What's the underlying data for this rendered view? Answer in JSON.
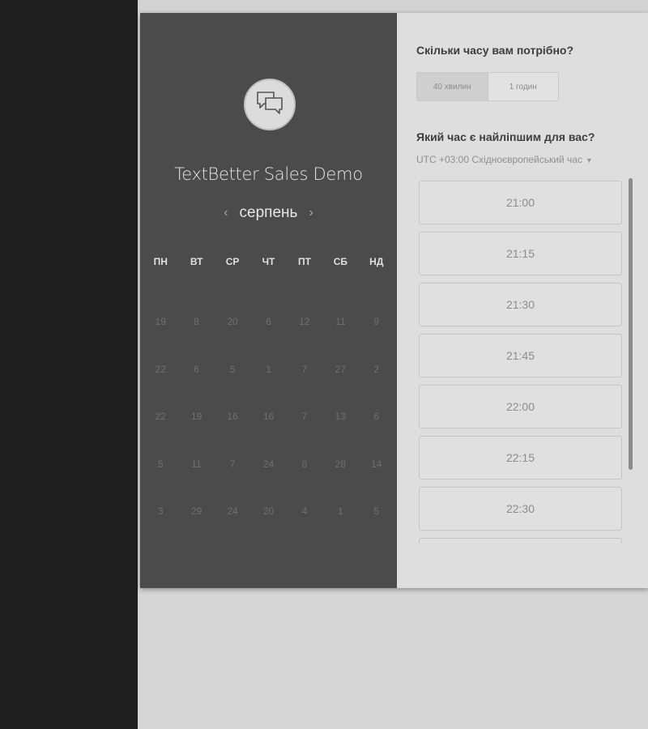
{
  "event": {
    "title": "TextBetter Sales Demo",
    "icon": "chat-bubbles-icon"
  },
  "calendar": {
    "month": "серпень",
    "prev_arrow": "‹",
    "next_arrow": "›",
    "weekdays": [
      "ПН",
      "ВТ",
      "СР",
      "ЧТ",
      "ПТ",
      "СБ",
      "НД"
    ],
    "weeks": [
      [
        "19",
        "8",
        "20",
        "6",
        "12",
        "11",
        "9"
      ],
      [
        "22",
        "6",
        "5",
        "1",
        "7",
        "27",
        "2"
      ],
      [
        "22",
        "19",
        "16",
        "16",
        "7",
        "13",
        "6"
      ],
      [
        "5",
        "11",
        "7",
        "24",
        "8",
        "28",
        "14"
      ],
      [
        "3",
        "29",
        "24",
        "20",
        "4",
        "1",
        "5"
      ]
    ]
  },
  "duration": {
    "question": "Скільки часу вам потрібно?",
    "options": [
      "40 хвилин",
      "1 годин"
    ],
    "selected": "40 хвилин"
  },
  "time_select": {
    "question": "Який час є найліпшим для вас?",
    "timezone": "UTC +03:00 Східноєвропейський час",
    "slots": [
      "21:00",
      "21:15",
      "21:30",
      "21:45",
      "22:00",
      "22:15",
      "22:30",
      ""
    ]
  },
  "colors": {
    "calendar_bg": "#4b4b4b",
    "left_bar": "#1e1e1e",
    "page_bg": "#d6d6d6"
  }
}
